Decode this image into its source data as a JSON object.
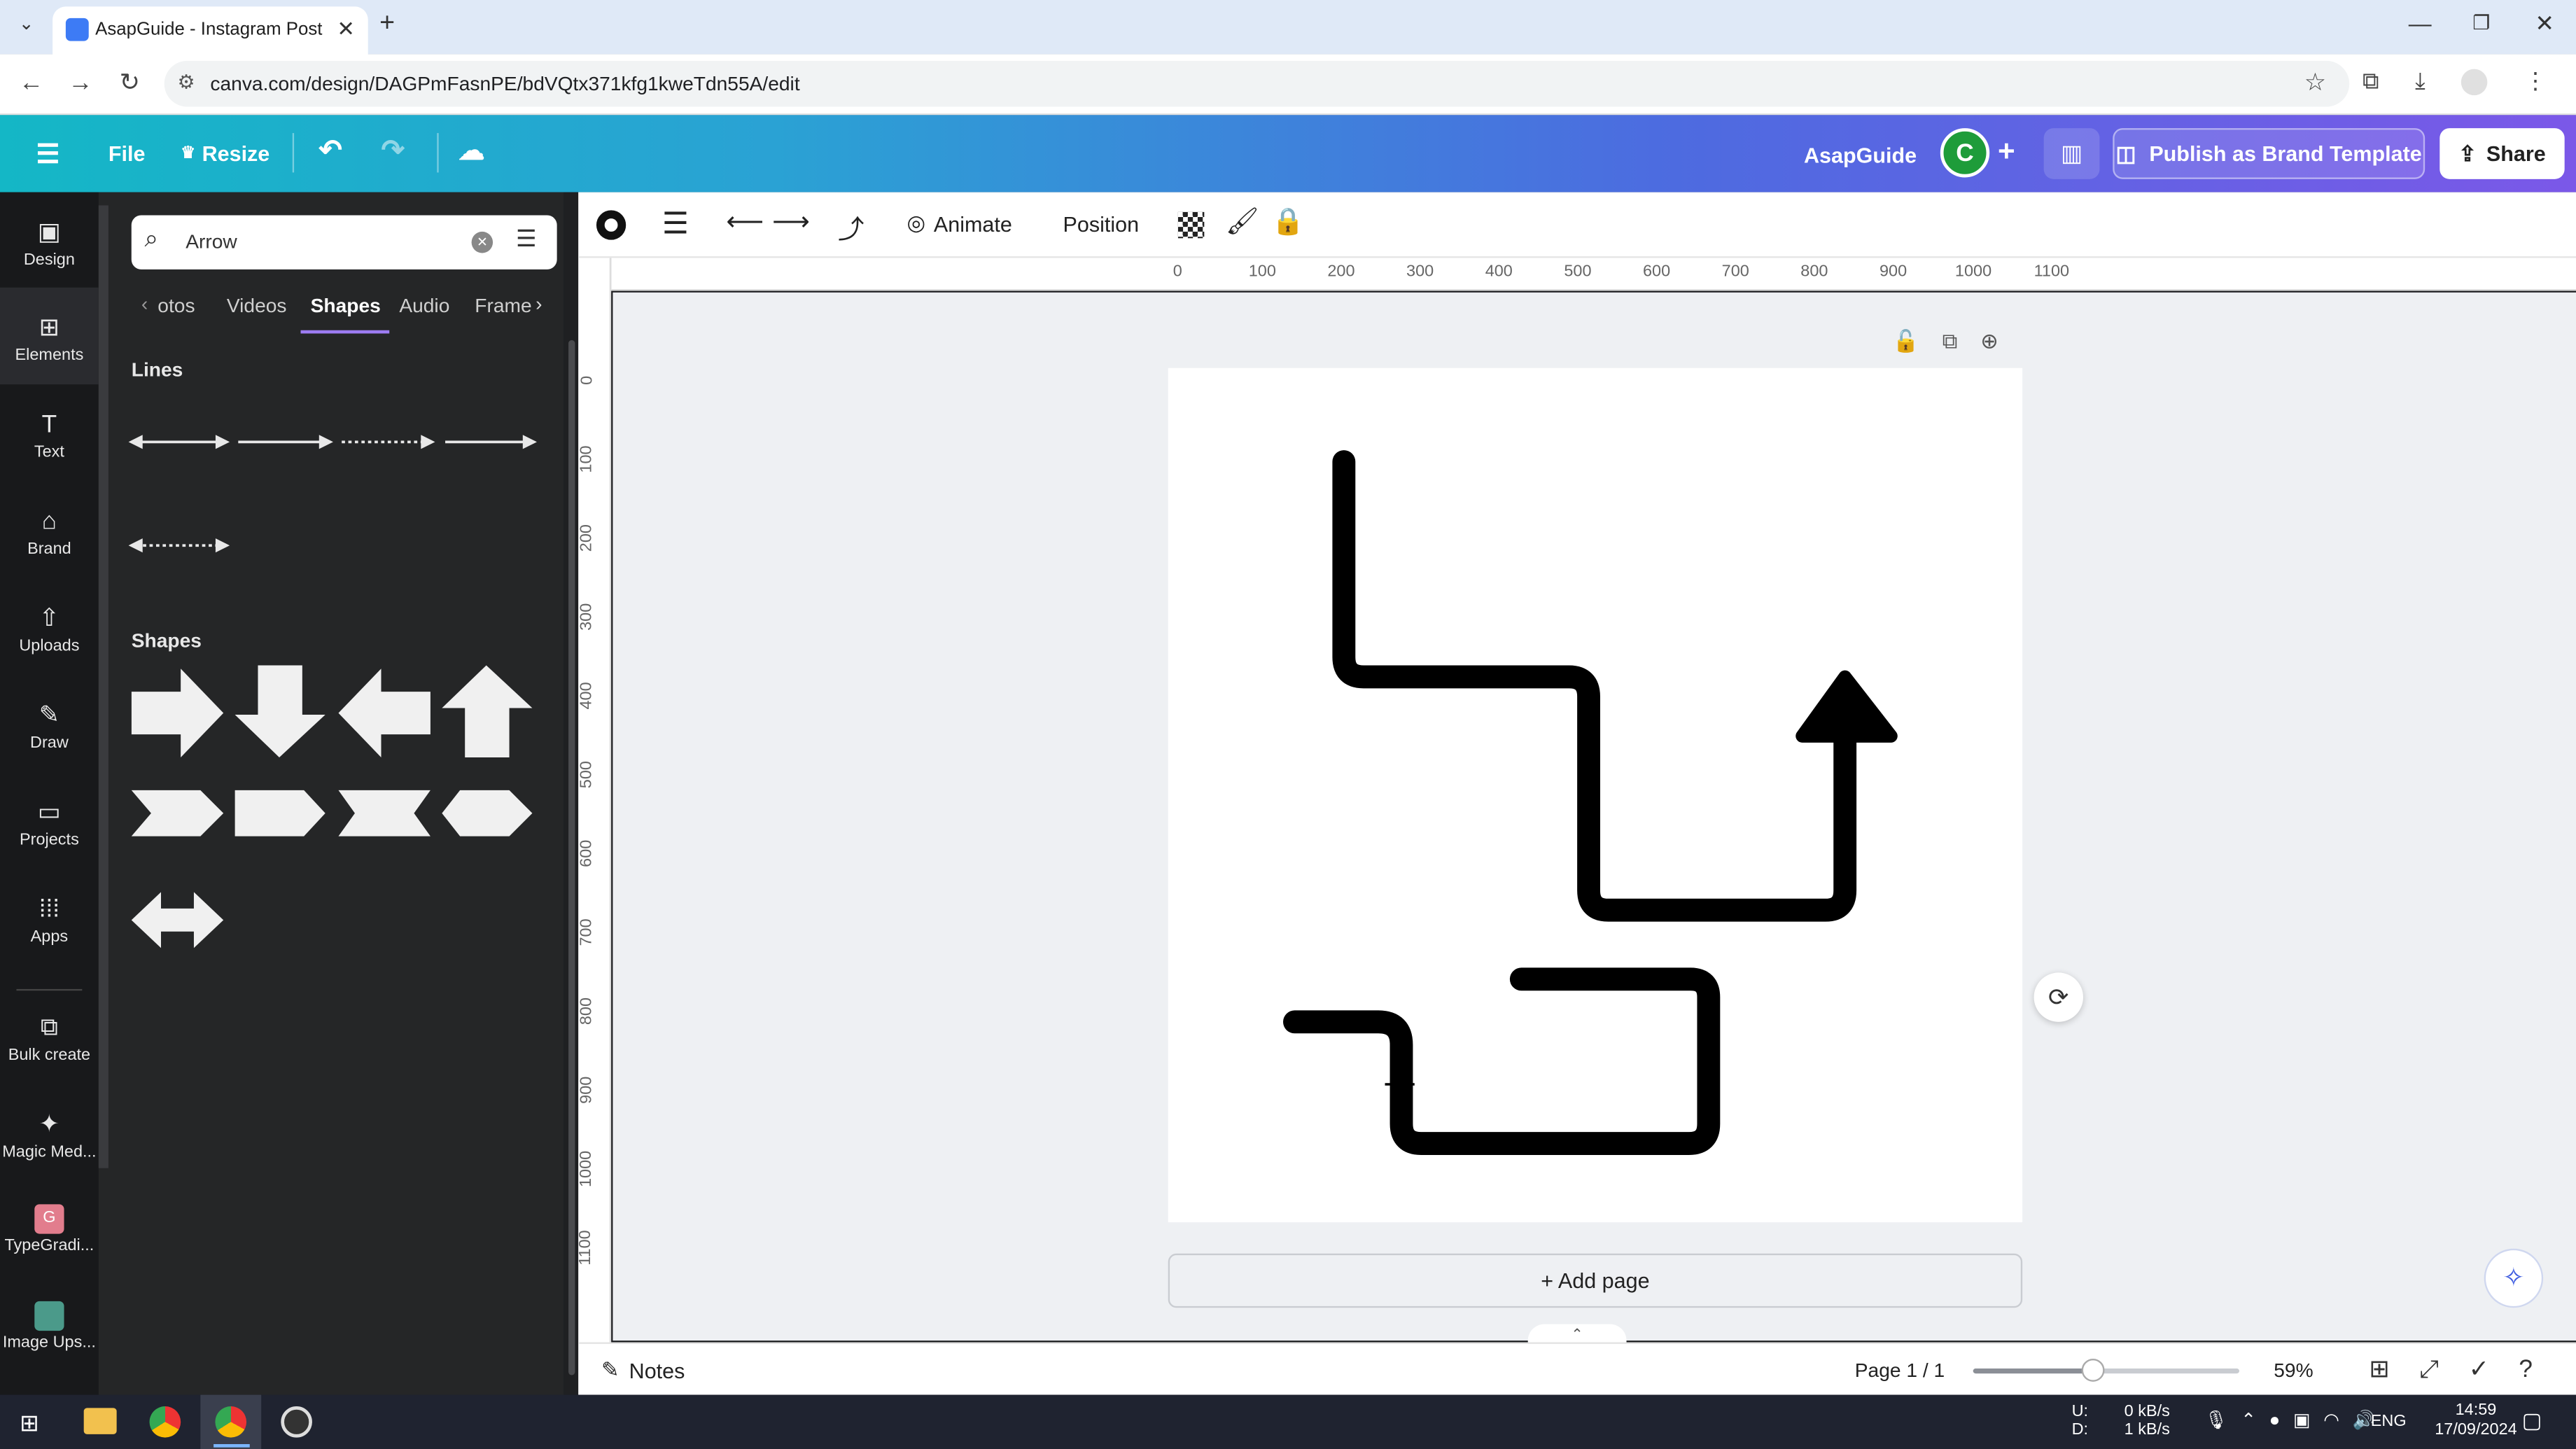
{
  "browser": {
    "tab_title": "AsapGuide - Instagram Post",
    "url": "canva.com/design/DAGPmFasnPE/bdVQtx371kfg1kweTdn55A/edit"
  },
  "header": {
    "file": "File",
    "resize": "Resize",
    "project_name": "AsapGuide",
    "avatar_letter": "C",
    "publish": "Publish as Brand Template",
    "share": "Share"
  },
  "rail": [
    {
      "label": "Design"
    },
    {
      "label": "Elements"
    },
    {
      "label": "Text"
    },
    {
      "label": "Brand"
    },
    {
      "label": "Uploads"
    },
    {
      "label": "Draw"
    },
    {
      "label": "Projects"
    },
    {
      "label": "Apps"
    },
    {
      "label": "Bulk create"
    },
    {
      "label": "Magic Med..."
    },
    {
      "label": "TypeGradi..."
    },
    {
      "label": "Image Ups..."
    }
  ],
  "panel": {
    "search_value": "Arrow",
    "tabs": [
      "otos",
      "Videos",
      "Shapes",
      "Audio",
      "Frame"
    ],
    "active_tab": "Shapes",
    "lines_heading": "Lines",
    "shapes_heading": "Shapes"
  },
  "toolbar": {
    "animate": "Animate",
    "position": "Position"
  },
  "ruler_h": [
    "0",
    "100",
    "200",
    "300",
    "400",
    "500",
    "600",
    "700",
    "800",
    "900",
    "1000",
    "1100"
  ],
  "ruler_v": [
    "0",
    "100",
    "200",
    "300",
    "400",
    "500",
    "600",
    "700",
    "800",
    "900",
    "1000",
    "1100"
  ],
  "canvas": {
    "add_page": "+ Add page"
  },
  "footer": {
    "notes": "Notes",
    "page": "Page 1 / 1",
    "zoom": "59%",
    "zoom_level": 0.45
  },
  "taskbar": {
    "net_up_label": "U:",
    "net_down_label": "D:",
    "net_up": "0 kB/s",
    "net_down": "1 kB/s",
    "lang": "ENG",
    "time": "14:59",
    "date": "17/09/2024"
  }
}
